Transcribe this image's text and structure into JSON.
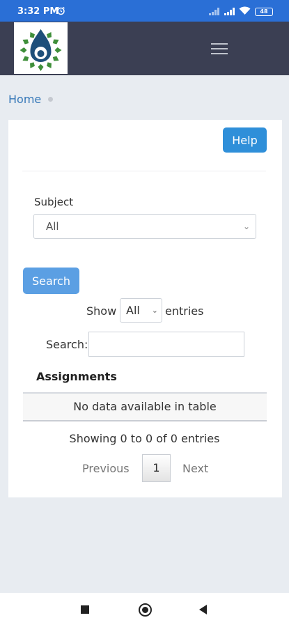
{
  "status_bar": {
    "time": "3:32 PM",
    "battery": "48",
    "icons": [
      "alarm-icon",
      "signal-icon",
      "signal-icon",
      "wifi-icon",
      "battery-icon"
    ]
  },
  "header": {
    "logo_icon": "org-logo",
    "menu_icon": "hamburger-menu-icon"
  },
  "breadcrumb": {
    "home_label": "Home"
  },
  "toolbar": {
    "help_label": "Help"
  },
  "filters": {
    "subject_label": "Subject",
    "subject_value": "All",
    "search_button_label": "Search"
  },
  "table_controls": {
    "show_label": "Show",
    "page_length_value": "All",
    "entries_label": "entries",
    "search_label": "Search:",
    "search_value": ""
  },
  "table": {
    "title": "Assignments",
    "empty_message": "No data available in table",
    "info": "Showing 0 to 0 of 0 entries"
  },
  "pagination": {
    "previous_label": "Previous",
    "current_page": "1",
    "next_label": "Next"
  },
  "colors": {
    "status_bar": "#2a6fd6",
    "header": "#3b3f53",
    "primary": "#2f8fd9",
    "search_button": "#5b9fe3",
    "link": "#3577b8"
  }
}
